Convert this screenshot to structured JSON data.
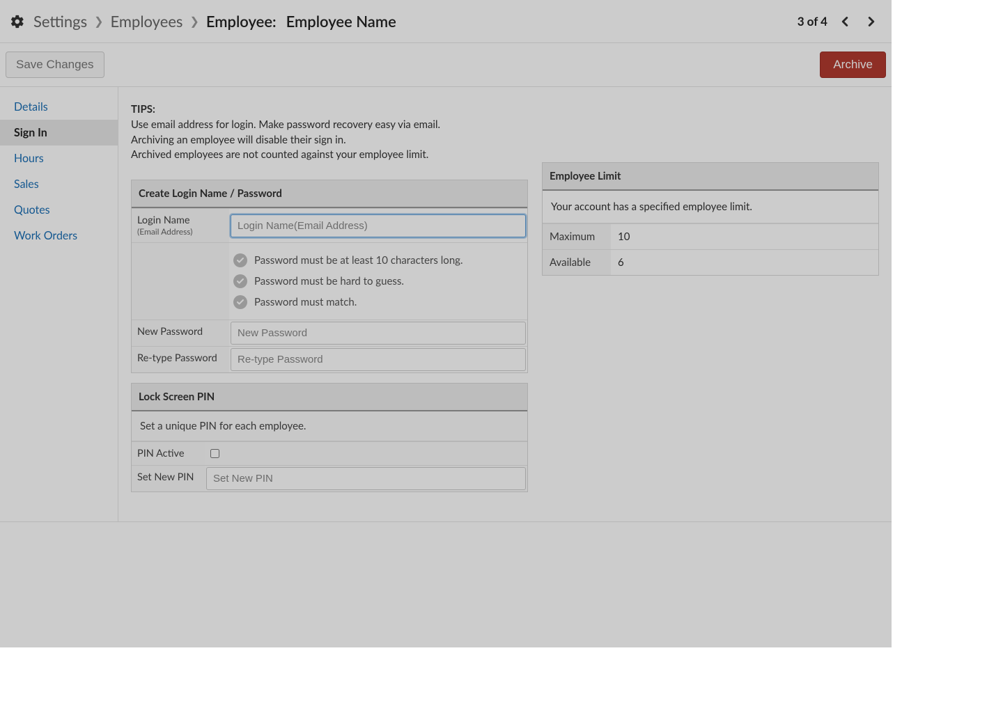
{
  "breadcrumb": {
    "settings": "Settings",
    "employees": "Employees",
    "current_label": "Employee:",
    "current_name": "Employee Name"
  },
  "pager": {
    "text": "3 of 4"
  },
  "actions": {
    "save": "Save Changes",
    "archive": "Archive"
  },
  "sidebar": {
    "items": [
      {
        "label": "Details"
      },
      {
        "label": "Sign In"
      },
      {
        "label": "Hours"
      },
      {
        "label": "Sales"
      },
      {
        "label": "Quotes"
      },
      {
        "label": "Work Orders"
      }
    ],
    "active_index": 1
  },
  "tips": {
    "label": "TIPS:",
    "lines": [
      "Use email address for login. Make password recovery easy via email.",
      "Archiving an employee will disable their sign in.",
      "Archived employees are not counted against your employee limit."
    ]
  },
  "login_panel": {
    "title": "Create Login Name / Password",
    "login_label": "Login Name",
    "login_sublabel": "(Email Address)",
    "login_placeholder": "Login Name(Email Address)",
    "reqs": [
      "Password must be at least 10 characters long.",
      "Password must be hard to guess.",
      "Password must match."
    ],
    "new_pw_label": "New Password",
    "new_pw_placeholder": "New Password",
    "retype_label": "Re-type Password",
    "retype_placeholder": "Re-type Password"
  },
  "pin_panel": {
    "title": "Lock Screen PIN",
    "note": "Set a unique PIN for each employee.",
    "active_label": "PIN Active",
    "set_label": "Set New PIN",
    "set_placeholder": "Set New PIN"
  },
  "limit_panel": {
    "title": "Employee Limit",
    "note": "Your account has a specified employee limit.",
    "max_label": "Maximum",
    "max_value": "10",
    "avail_label": "Available",
    "avail_value": "6"
  }
}
